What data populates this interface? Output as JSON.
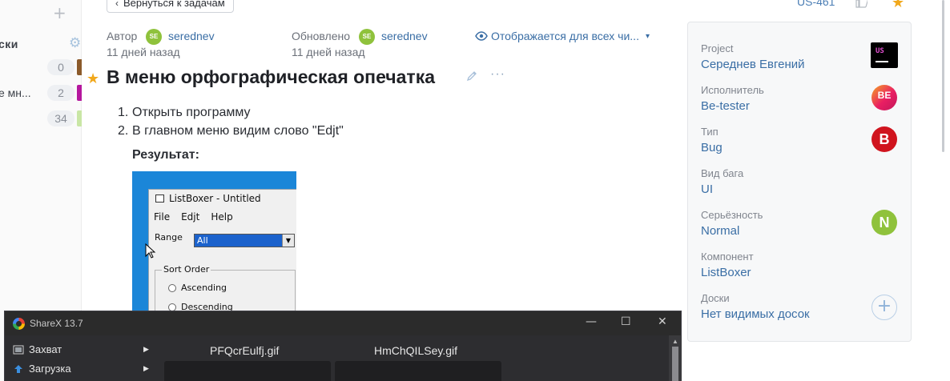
{
  "sidebar": {
    "boards_heading": "ски",
    "row_label": "е мн...",
    "counts": [
      "0",
      "2",
      "34"
    ],
    "strip_colors": [
      "#8b5a2b",
      "#b5179e",
      "#c9e6a5"
    ]
  },
  "topbar": {
    "back_label": "Вернуться к задачам",
    "issue_id": "US-461"
  },
  "meta": {
    "author_label": "Автор",
    "author_initials": "SE",
    "author_name": "serednev",
    "author_date": "11 дней назад",
    "updated_label": "Обновлено",
    "updated_initials": "SE",
    "updated_name": "serednev",
    "updated_date": "11 дней назад",
    "visibility": "Отображается для всех чи..."
  },
  "issue": {
    "title": "В меню орфографическая опечатка",
    "steps": [
      {
        "n": "1.",
        "text": "Открыть программу"
      },
      {
        "n": "2.",
        "text": "В главном меню видим слово \"Edjt\""
      }
    ],
    "result_label": "Результат:"
  },
  "embedded_screenshot": {
    "window_title": "ListBoxer - Untitled",
    "menu": [
      "File",
      "Edjt",
      "Help"
    ],
    "range_label": "Range",
    "range_value": "All",
    "group_label": "Sort Order",
    "radios": [
      "Ascending",
      "Descending"
    ]
  },
  "panel": {
    "fields": [
      {
        "label": "Project",
        "value": "Середнев Евгений"
      },
      {
        "label": "Исполнитель",
        "value": "Be-tester",
        "avatar": "BE"
      },
      {
        "label": "Тип",
        "value": "Bug",
        "avatar": "B"
      },
      {
        "label": "Вид бага",
        "value": "UI"
      },
      {
        "label": "Серьёзность",
        "value": "Normal",
        "avatar": "N"
      },
      {
        "label": "Компонент",
        "value": "ListBoxer"
      },
      {
        "label": "Доски",
        "value": "Нет видимых досок"
      }
    ],
    "project_logo_text": "US",
    "add_symbol": "+"
  },
  "sharex": {
    "title": "ShareX 13.7",
    "menu": [
      "Захват",
      "Загрузка"
    ],
    "files": [
      "PFQcrEulfj.gif",
      "HmChQILSey.gif"
    ],
    "controls": [
      "—",
      "☐",
      "✕"
    ]
  },
  "colors": {
    "accent_blue": "#3a6ea5",
    "star": "#f1a81c",
    "avatar_green": "#8fc23c",
    "bug_red": "#d0141e"
  }
}
